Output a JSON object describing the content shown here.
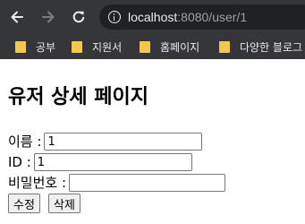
{
  "browser": {
    "url_host": "localhost",
    "url_rest": ":8080/user/1"
  },
  "bookmarks": [
    {
      "label": "공부"
    },
    {
      "label": "지원서"
    },
    {
      "label": "홈페이지"
    },
    {
      "label": "다양한 블로그"
    }
  ],
  "page": {
    "title": "유저 상세 페이지",
    "fields": [
      {
        "label": "이름 :",
        "value": ""
      },
      {
        "label": "ID :",
        "value": "1"
      },
      {
        "label": "비밀번호 :",
        "value": ""
      }
    ],
    "name_value": "1",
    "buttons": {
      "edit": "수정",
      "delete": "삭제"
    }
  }
}
